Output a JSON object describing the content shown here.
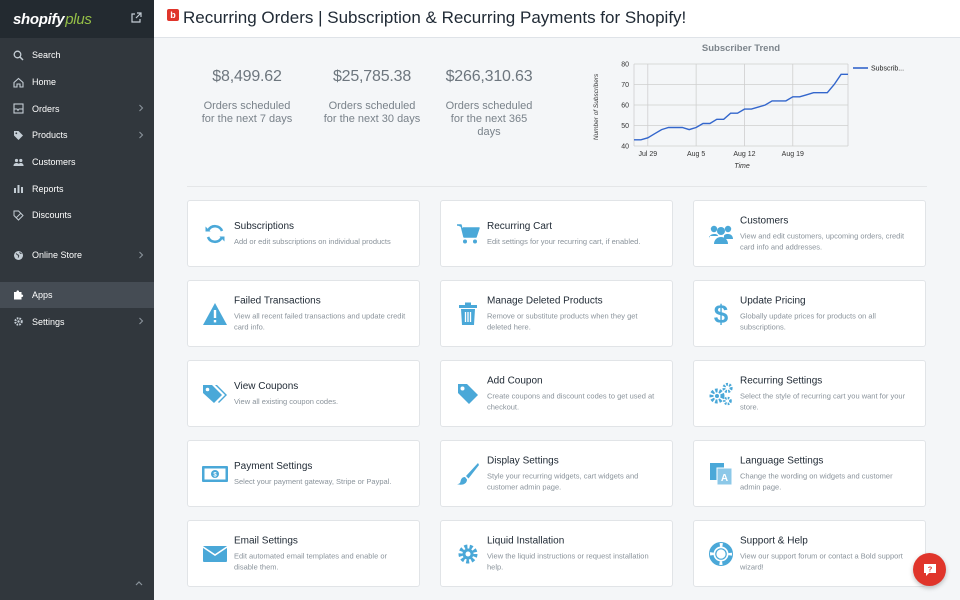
{
  "sidebar": {
    "brand": "shopify",
    "brand_plus": "plus",
    "items": [
      {
        "label": "Search",
        "icon": "search-icon"
      },
      {
        "label": "Home",
        "icon": "home-icon"
      },
      {
        "label": "Orders",
        "icon": "orders-icon"
      },
      {
        "label": "Products",
        "icon": "tag-icon"
      },
      {
        "label": "Customers",
        "icon": "customers-icon"
      },
      {
        "label": "Reports",
        "icon": "reports-icon"
      },
      {
        "label": "Discounts",
        "icon": "discounts-icon"
      },
      {
        "label": "Online Store",
        "icon": "globe-icon"
      },
      {
        "label": "Apps",
        "icon": "puzzle-icon"
      },
      {
        "label": "Settings",
        "icon": "gear-icon"
      }
    ],
    "active": "Apps"
  },
  "header": {
    "badge": "b",
    "title": "Recurring Orders | Subscription & Recurring Payments for Shopify!"
  },
  "stats": [
    {
      "value": "$8,499.62",
      "desc": "Orders scheduled for the next 7 days"
    },
    {
      "value": "$25,785.38",
      "desc": "Orders scheduled for the next 30 days"
    },
    {
      "value": "$266,310.63",
      "desc": "Orders scheduled for the next 365 days"
    }
  ],
  "chart_data": {
    "type": "line",
    "title": "Subscriber Trend",
    "xlabel": "Time",
    "ylabel": "Number of Subscribers",
    "ylim": [
      40,
      80
    ],
    "yticks": [
      40,
      50,
      60,
      70,
      80
    ],
    "xticks": [
      "Jul 29",
      "Aug 5",
      "Aug 12",
      "Aug 19"
    ],
    "xtick_index": [
      2,
      9,
      16,
      23
    ],
    "grid": true,
    "legend": "top-right",
    "color": "#3366cc",
    "series": [
      {
        "name": "Subscrib...",
        "values": [
          43,
          43,
          44,
          46,
          48,
          49,
          49,
          49,
          48,
          49,
          51,
          51,
          53,
          53,
          56,
          56,
          58,
          58,
          59,
          60,
          62,
          62,
          62,
          64,
          64,
          65,
          66,
          66,
          66,
          70,
          75,
          75
        ]
      }
    ]
  },
  "cards": [
    {
      "title": "Subscriptions",
      "desc": "Add or edit subscriptions on individual products",
      "icon": "refresh-icon"
    },
    {
      "title": "Recurring Cart",
      "desc": "Edit settings for your recurring cart, if enabled.",
      "icon": "cart-icon"
    },
    {
      "title": "Customers",
      "desc": "View and edit customers, upcoming orders, credit card info and addresses.",
      "icon": "users-icon"
    },
    {
      "title": "Failed Transactions",
      "desc": "View all recent failed transactions and update credit card info.",
      "icon": "warning-icon"
    },
    {
      "title": "Manage Deleted Products",
      "desc": "Remove or substitute products when they get deleted here.",
      "icon": "trash-icon"
    },
    {
      "title": "Update Pricing",
      "desc": "Globally update prices for products on all subscriptions.",
      "icon": "dollar-icon"
    },
    {
      "title": "View Coupons",
      "desc": "View all existing coupon codes.",
      "icon": "tags-icon"
    },
    {
      "title": "Add Coupon",
      "desc": "Create coupons and discount codes to get used at checkout.",
      "icon": "tag-icon"
    },
    {
      "title": "Recurring Settings",
      "desc": "Select the style of recurring cart you want for your store.",
      "icon": "gears-icon"
    },
    {
      "title": "Payment Settings",
      "desc": "Select your payment gateway, Stripe or Paypal.",
      "icon": "money-icon"
    },
    {
      "title": "Display Settings",
      "desc": "Style your recurring widgets, cart widgets and customer admin page.",
      "icon": "brush-icon"
    },
    {
      "title": "Language Settings",
      "desc": "Change the wording on widgets and customer admin page.",
      "icon": "language-icon"
    },
    {
      "title": "Email Settings",
      "desc": "Edit automated email templates and enable or disable them.",
      "icon": "envelope-icon"
    },
    {
      "title": "Liquid Installation",
      "desc": "View the liquid instructions or request installation help.",
      "icon": "cog-icon"
    },
    {
      "title": "Support & Help",
      "desc": "View our support forum or contact a Bold support wizard!",
      "icon": "lifebuoy-icon"
    }
  ],
  "colors": {
    "sidebar": "#31373d",
    "accent_icon": "#4aa8d8",
    "badge_red": "#e0352b",
    "shopify_green": "#95bf47"
  },
  "help_button_icon": "chat-help-icon"
}
